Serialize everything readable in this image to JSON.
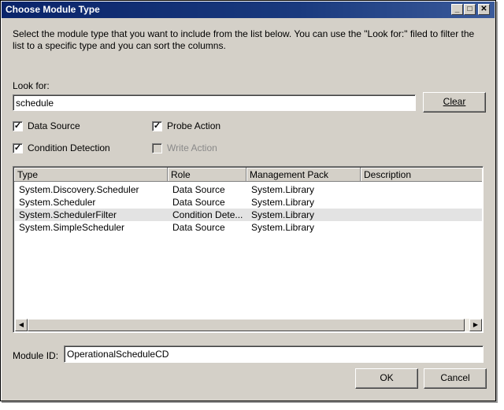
{
  "window": {
    "title": "Choose Module Type",
    "description": "Select the module type that you want to include from the list below.  You can use the \"Look for:\" filed to filter the list to a specific type and you can sort the columns."
  },
  "search": {
    "label": "Look for:",
    "value": "schedule",
    "clear_label": "Clear"
  },
  "filters": [
    {
      "label": "Data Source",
      "checked": true,
      "enabled": true
    },
    {
      "label": "Probe Action",
      "checked": true,
      "enabled": true
    },
    {
      "label": "Condition Detection",
      "checked": true,
      "enabled": true
    },
    {
      "label": "Write Action",
      "checked": false,
      "enabled": false
    }
  ],
  "table": {
    "columns": [
      "Type",
      "Role",
      "Management Pack",
      "Description"
    ],
    "rows": [
      {
        "type": "System.Discovery.Scheduler",
        "role": "Data Source",
        "pack": "System.Library",
        "description": ""
      },
      {
        "type": "System.Scheduler",
        "role": "Data Source",
        "pack": "System.Library",
        "description": ""
      },
      {
        "type": "System.SchedulerFilter",
        "role": "Condition Dete...",
        "pack": "System.Library",
        "description": ""
      },
      {
        "type": "System.SimpleScheduler",
        "role": "Data Source",
        "pack": "System.Library",
        "description": ""
      }
    ],
    "selected_row": 2
  },
  "module_id": {
    "label": "Module ID:",
    "value": "OperationalScheduleCD"
  },
  "buttons": {
    "ok": "OK",
    "cancel": "Cancel"
  },
  "icons": {
    "minimize": "minimize-icon",
    "maximize": "maximize-icon",
    "close": "close-icon",
    "checkmark": "checkmark-icon",
    "scroll_left": "arrow-left-icon",
    "scroll_right": "arrow-right-icon"
  }
}
